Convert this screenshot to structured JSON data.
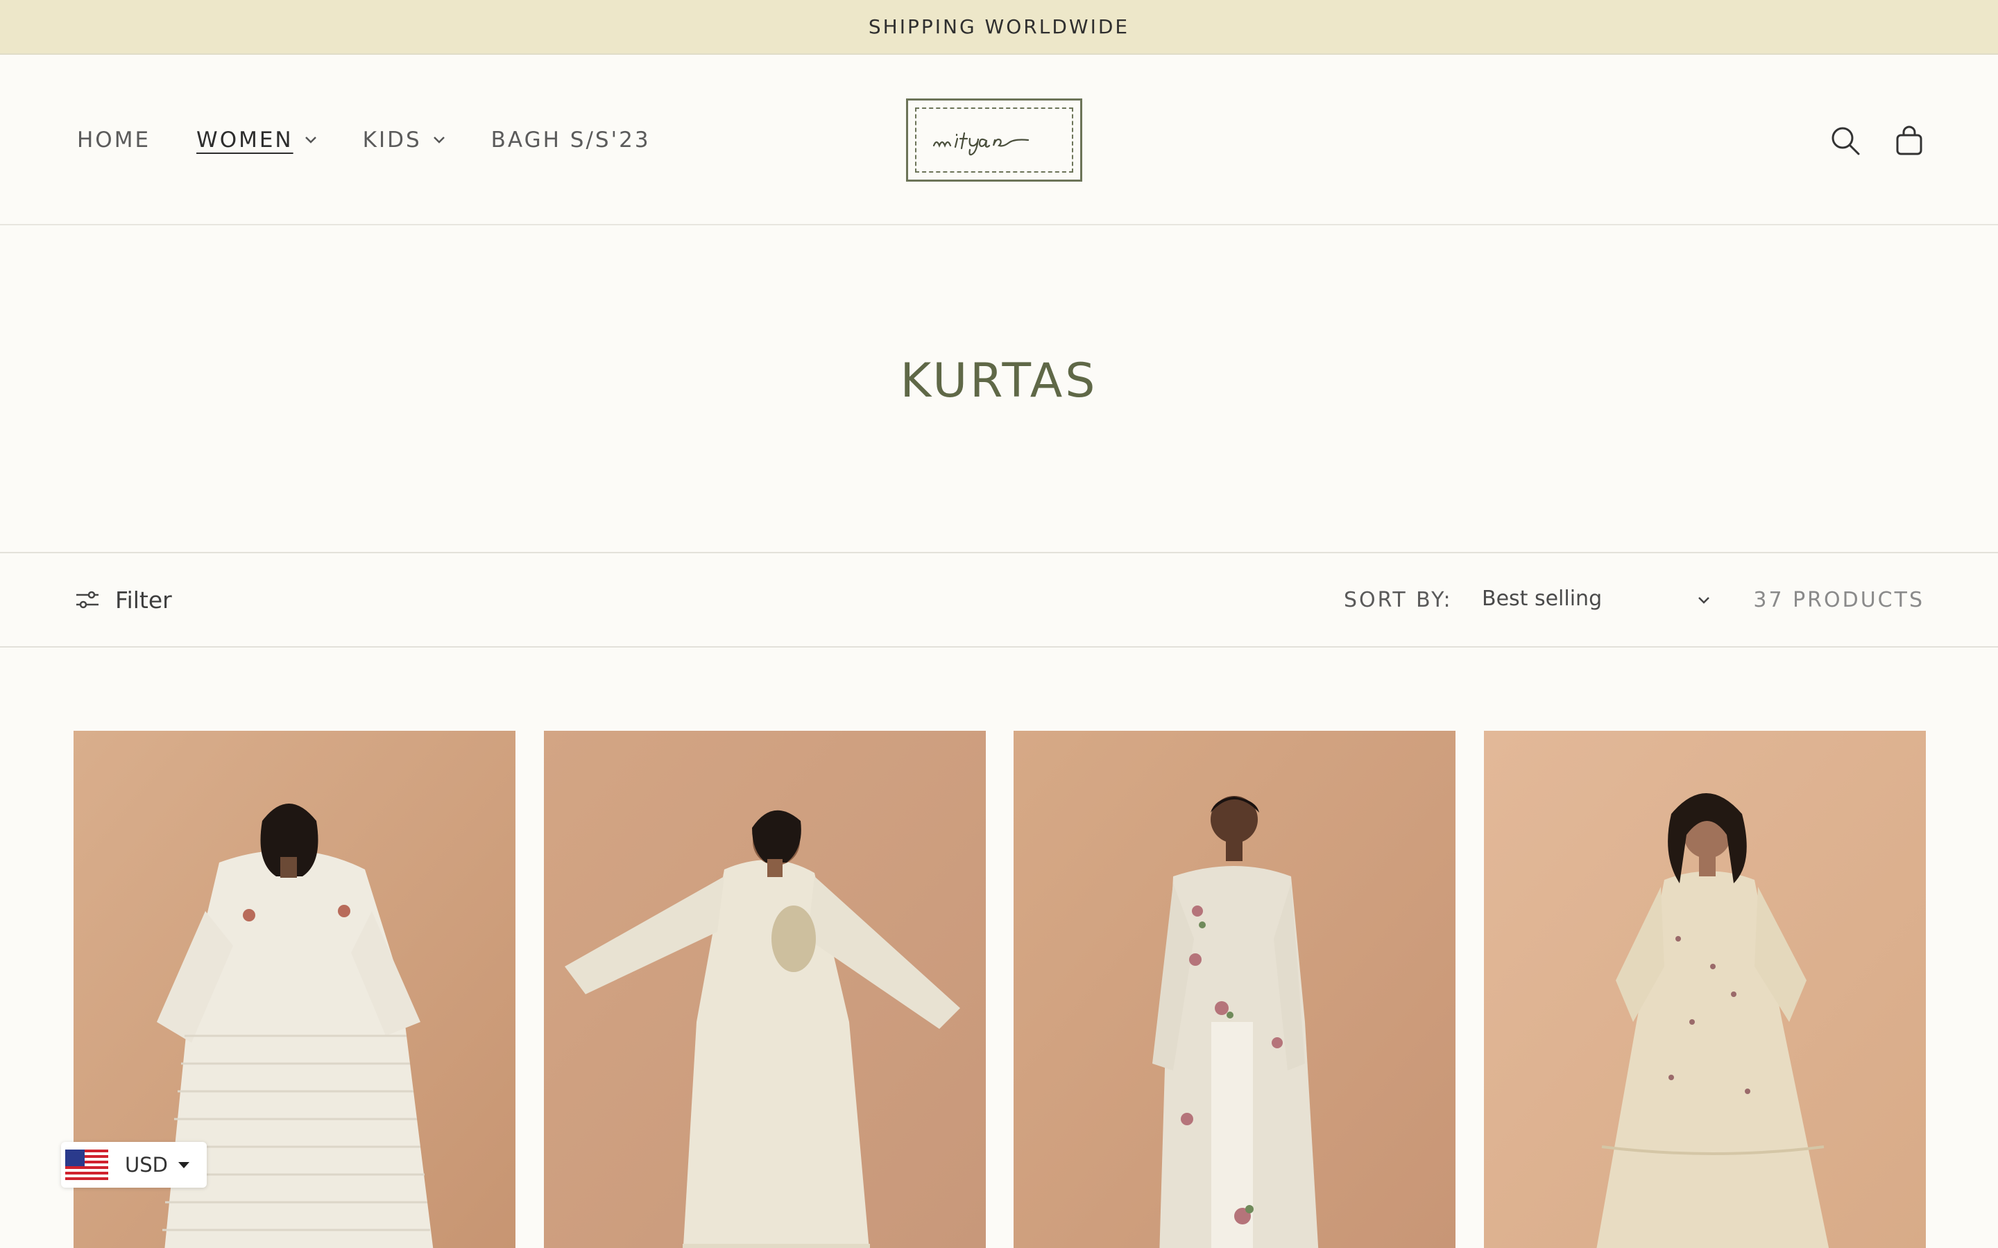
{
  "announcement": {
    "text": "SHIPPING WORLDWIDE"
  },
  "nav": {
    "items": [
      {
        "label": "HOME",
        "dropdown": false
      },
      {
        "label": "WOMEN",
        "dropdown": true,
        "active": true
      },
      {
        "label": "KIDS",
        "dropdown": true
      },
      {
        "label": "BAGH S/S'23",
        "dropdown": false
      }
    ]
  },
  "logo": {
    "text": "mityan"
  },
  "header_icons": [
    "search-icon",
    "cart-icon"
  ],
  "collection": {
    "title": "KURTAS"
  },
  "toolbar": {
    "filter_label": "Filter",
    "sort_label": "SORT BY:",
    "sort_value": "Best selling",
    "product_count": "37 PRODUCTS"
  },
  "products": [
    {
      "image": "woman in white striped organza kurta with embroidered yoke"
    },
    {
      "image": "woman in ivory kurta with floral embroidery, arms outstretched"
    },
    {
      "image": "woman in sheer ivory kurta with pink floral embroidery"
    },
    {
      "image": "woman in tiered ivory kurta dress with scattered embroidery"
    }
  ],
  "currency": {
    "code": "USD"
  },
  "colors": {
    "announcement_bg": "#ede7c9",
    "page_bg": "#fcfbf7",
    "accent_olive": "#5f6847",
    "photo_bg": "#c99a78"
  }
}
